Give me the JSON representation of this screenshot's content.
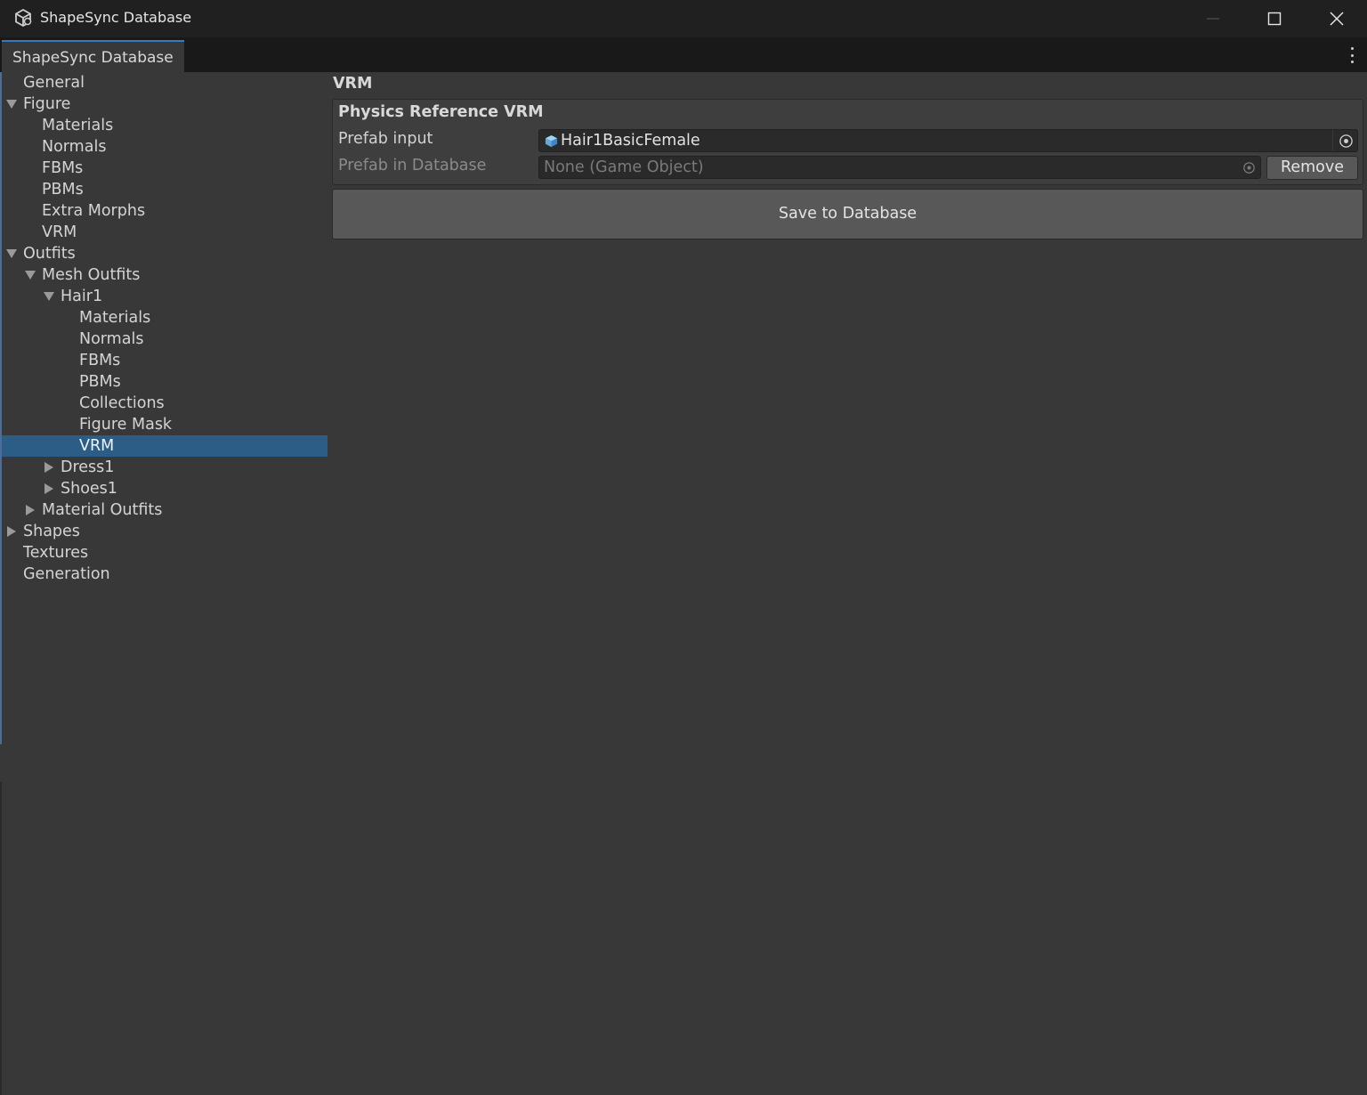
{
  "window": {
    "title": "ShapeSync Database",
    "icon": "unity-cube-icon",
    "controls": [
      "minimize-icon",
      "maximize-icon",
      "close-icon"
    ]
  },
  "tabbar": {
    "active_tab": "ShapeSync Database",
    "menu_icon": "more-vertical-icon"
  },
  "tree": {
    "items": [
      {
        "label": "General",
        "depth": 0,
        "arrow": "none"
      },
      {
        "label": "Figure",
        "depth": 0,
        "arrow": "expanded"
      },
      {
        "label": "Materials",
        "depth": 1,
        "arrow": "none"
      },
      {
        "label": "Normals",
        "depth": 1,
        "arrow": "none"
      },
      {
        "label": "FBMs",
        "depth": 1,
        "arrow": "none"
      },
      {
        "label": "PBMs",
        "depth": 1,
        "arrow": "none"
      },
      {
        "label": "Extra Morphs",
        "depth": 1,
        "arrow": "none"
      },
      {
        "label": "VRM",
        "depth": 1,
        "arrow": "none"
      },
      {
        "label": "Outfits",
        "depth": 0,
        "arrow": "expanded"
      },
      {
        "label": "Mesh Outfits",
        "depth": 1,
        "arrow": "expanded"
      },
      {
        "label": "Hair1",
        "depth": 2,
        "arrow": "expanded"
      },
      {
        "label": "Materials",
        "depth": 3,
        "arrow": "none"
      },
      {
        "label": "Normals",
        "depth": 3,
        "arrow": "none"
      },
      {
        "label": "FBMs",
        "depth": 3,
        "arrow": "none"
      },
      {
        "label": "PBMs",
        "depth": 3,
        "arrow": "none"
      },
      {
        "label": "Collections",
        "depth": 3,
        "arrow": "none"
      },
      {
        "label": "Figure Mask",
        "depth": 3,
        "arrow": "none"
      },
      {
        "label": "VRM",
        "depth": 3,
        "arrow": "none",
        "selected": true
      },
      {
        "label": "Dress1",
        "depth": 2,
        "arrow": "collapsed"
      },
      {
        "label": "Shoes1",
        "depth": 2,
        "arrow": "collapsed"
      },
      {
        "label": "Material Outfits",
        "depth": 1,
        "arrow": "collapsed"
      },
      {
        "label": "Shapes",
        "depth": 0,
        "arrow": "collapsed"
      },
      {
        "label": "Textures",
        "depth": 0,
        "arrow": "none"
      },
      {
        "label": "Generation",
        "depth": 0,
        "arrow": "none"
      }
    ]
  },
  "panel": {
    "section_title": "VRM",
    "group_title": "Physics Reference VRM",
    "prefab_input_label": "Prefab input",
    "prefab_input_value": "Hair1BasicFemale",
    "prefab_input_icon": "prefab-cube-icon",
    "prefab_db_label": "Prefab in Database",
    "prefab_db_value": "None (Game Object)",
    "remove_label": "Remove",
    "save_label": "Save to Database"
  },
  "colors": {
    "background": "#383838",
    "selection": "#2c5d87",
    "tab_accent": "#3a79bb",
    "button": "#585858"
  }
}
